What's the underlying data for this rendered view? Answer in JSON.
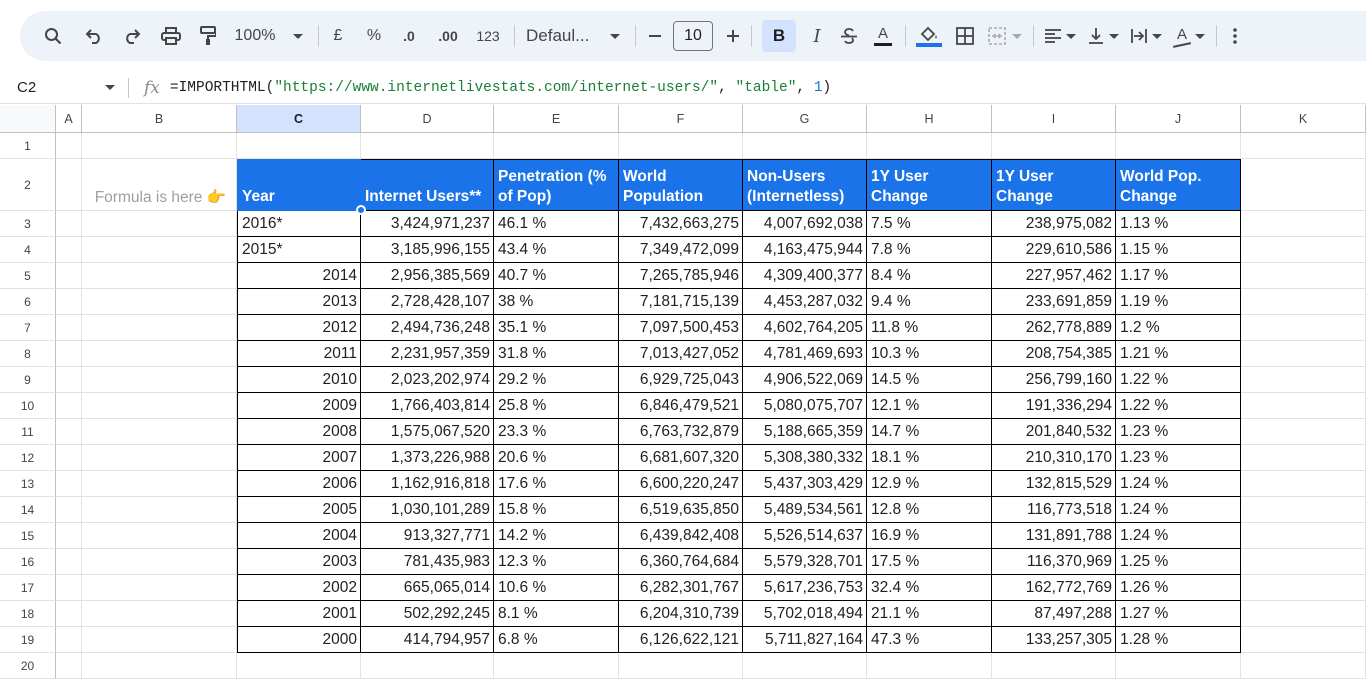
{
  "toolbar": {
    "zoom": "100%",
    "currency": "£",
    "percent": "%",
    "decrease_decimal": ".0",
    "increase_decimal": ".00",
    "number_format": "123",
    "font": "Defaul...",
    "font_size": "10",
    "bold": "B",
    "italic": "I",
    "text_color": "A",
    "text_rotate": "A"
  },
  "formula_bar": {
    "cell_ref": "C2",
    "fx": "fx",
    "formula_prefix": "=IMPORTHTML(",
    "formula_url": "\"https://www.internetlivestats.com/internet-users/\"",
    "formula_sep1": ", ",
    "formula_table": "\"table\"",
    "formula_sep2": ", ",
    "formula_index": "1",
    "formula_suffix": ")"
  },
  "columns": [
    "A",
    "B",
    "C",
    "D",
    "E",
    "F",
    "G",
    "H",
    "I",
    "J",
    "K"
  ],
  "rows": [
    "1",
    "2",
    "3",
    "4",
    "5",
    "6",
    "7",
    "8",
    "9",
    "10",
    "11",
    "12",
    "13",
    "14",
    "15",
    "16",
    "17",
    "18",
    "19",
    "20"
  ],
  "note": "Formula is here 👉",
  "table": {
    "headers": [
      "Year",
      "Internet Users**",
      "Penetration (% of Pop)",
      "World Population",
      "Non-Users (Internetless)",
      "1Y User Change",
      "1Y User Change",
      "World Pop. Change"
    ],
    "rows": [
      [
        "2016*",
        "3,424,971,237",
        "46.1 %",
        "7,432,663,275",
        "4,007,692,038",
        "7.5 %",
        "238,975,082",
        "1.13 %"
      ],
      [
        "2015*",
        "3,185,996,155",
        "43.4 %",
        "7,349,472,099",
        "4,163,475,944",
        "7.8 %",
        "229,610,586",
        "1.15 %"
      ],
      [
        "2014",
        "2,956,385,569",
        "40.7 %",
        "7,265,785,946",
        "4,309,400,377",
        "8.4 %",
        "227,957,462",
        "1.17 %"
      ],
      [
        "2013",
        "2,728,428,107",
        "38 %",
        "7,181,715,139",
        "4,453,287,032",
        "9.4 %",
        "233,691,859",
        "1.19 %"
      ],
      [
        "2012",
        "2,494,736,248",
        "35.1 %",
        "7,097,500,453",
        "4,602,764,205",
        "11.8 %",
        "262,778,889",
        "1.2 %"
      ],
      [
        "2011",
        "2,231,957,359",
        "31.8 %",
        "7,013,427,052",
        "4,781,469,693",
        "10.3 %",
        "208,754,385",
        "1.21 %"
      ],
      [
        "2010",
        "2,023,202,974",
        "29.2 %",
        "6,929,725,043",
        "4,906,522,069",
        "14.5 %",
        "256,799,160",
        "1.22 %"
      ],
      [
        "2009",
        "1,766,403,814",
        "25.8 %",
        "6,846,479,521",
        "5,080,075,707",
        "12.1 %",
        "191,336,294",
        "1.22 %"
      ],
      [
        "2008",
        "1,575,067,520",
        "23.3 %",
        "6,763,732,879",
        "5,188,665,359",
        "14.7 %",
        "201,840,532",
        "1.23 %"
      ],
      [
        "2007",
        "1,373,226,988",
        "20.6 %",
        "6,681,607,320",
        "5,308,380,332",
        "18.1 %",
        "210,310,170",
        "1.23 %"
      ],
      [
        "2006",
        "1,162,916,818",
        "17.6 %",
        "6,600,220,247",
        "5,437,303,429",
        "12.9 %",
        "132,815,529",
        "1.24 %"
      ],
      [
        "2005",
        "1,030,101,289",
        "15.8 %",
        "6,519,635,850",
        "5,489,534,561",
        "12.8 %",
        "116,773,518",
        "1.24 %"
      ],
      [
        "2004",
        "913,327,771",
        "14.2 %",
        "6,439,842,408",
        "5,526,514,637",
        "16.9 %",
        "131,891,788",
        "1.24 %"
      ],
      [
        "2003",
        "781,435,983",
        "12.3 %",
        "6,360,764,684",
        "5,579,328,701",
        "17.5 %",
        "116,370,969",
        "1.25 %"
      ],
      [
        "2002",
        "665,065,014",
        "10.6 %",
        "6,282,301,767",
        "5,617,236,753",
        "32.4 %",
        "162,772,769",
        "1.26 %"
      ],
      [
        "2001",
        "502,292,245",
        "8.1 %",
        "6,204,310,739",
        "5,702,018,494",
        "21.1 %",
        "87,497,288",
        "1.27 %"
      ],
      [
        "2000",
        "414,794,957",
        "6.8 %",
        "6,126,622,121",
        "5,711,827,164",
        "47.3 %",
        "133,257,305",
        "1.28 %"
      ]
    ]
  },
  "colors": {
    "header_bg": "#1a73e8",
    "selected_col": "#d3e3fd",
    "toolbar_bg": "#eef2f9",
    "fill_color_bar": "#1a73e8"
  }
}
